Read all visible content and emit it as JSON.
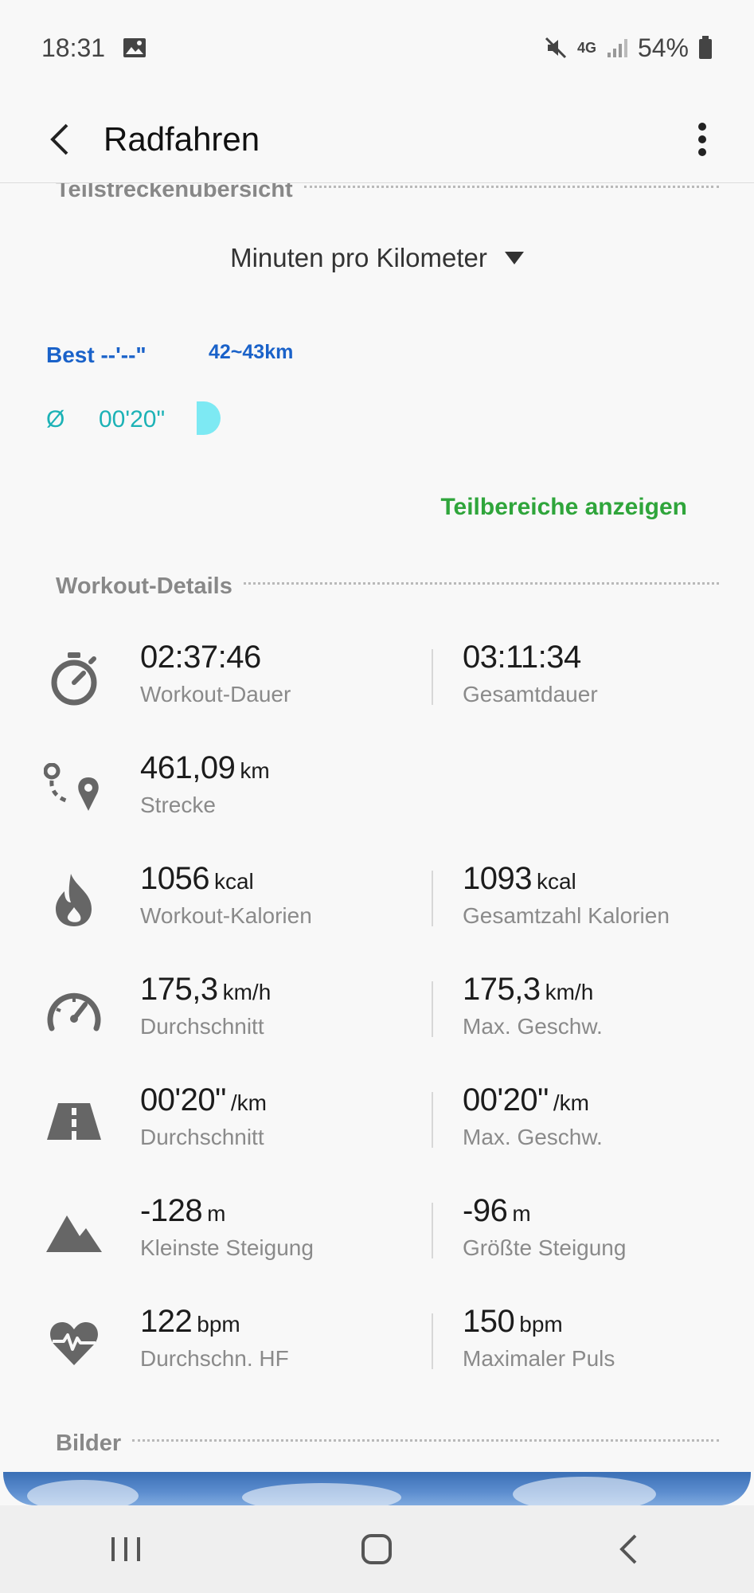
{
  "status_bar": {
    "time": "18:31",
    "network": "4G",
    "battery": "54%"
  },
  "app_bar": {
    "title": "Radfahren"
  },
  "split_overview": {
    "header": "Teilstreckenübersicht",
    "unit_selector": "Minuten pro Kilometer",
    "best_label": "Best --'--\"",
    "best_range": "42~43km",
    "avg_symbol": "Ø",
    "avg_value": "00'20\"",
    "show_segments": "Teilbereiche anzeigen"
  },
  "workout_details": {
    "header": "Workout-Details",
    "rows": [
      {
        "icon": "stopwatch-icon",
        "left": {
          "value": "02:37:46",
          "unit": "",
          "label": "Workout-Dauer"
        },
        "right": {
          "value": "03:11:34",
          "unit": "",
          "label": "Gesamtdauer"
        }
      },
      {
        "icon": "route-icon",
        "left": {
          "value": "461,09",
          "unit": "km",
          "label": "Strecke"
        }
      },
      {
        "icon": "flame-icon",
        "left": {
          "value": "1056",
          "unit": "kcal",
          "label": "Workout-Kalorien"
        },
        "right": {
          "value": "1093",
          "unit": "kcal",
          "label": "Gesamtzahl Kalorien"
        }
      },
      {
        "icon": "speedometer-icon",
        "left": {
          "value": "175,3",
          "unit": "km/h",
          "label": "Durchschnitt"
        },
        "right": {
          "value": "175,3",
          "unit": "km/h",
          "label": "Max. Geschw."
        }
      },
      {
        "icon": "road-icon",
        "left": {
          "value": "00'20\"",
          "unit": "/km",
          "label": "Durchschnitt"
        },
        "right": {
          "value": "00'20\"",
          "unit": "/km",
          "label": "Max. Geschw."
        }
      },
      {
        "icon": "mountain-icon",
        "left": {
          "value": "-128",
          "unit": "m",
          "label": "Kleinste Steigung"
        },
        "right": {
          "value": "-96",
          "unit": "m",
          "label": "Größte Steigung"
        }
      },
      {
        "icon": "heart-rate-icon",
        "left": {
          "value": "122",
          "unit": "bpm",
          "label": "Durchschn. HF"
        },
        "right": {
          "value": "150",
          "unit": "bpm",
          "label": "Maximaler Puls"
        }
      }
    ]
  },
  "pictures": {
    "header": "Bilder"
  },
  "colors": {
    "best": "#1a62c9",
    "average": "#1cb2b6",
    "split_bar": "#7de9f3",
    "link_green": "#2fa53b",
    "icon_gray": "#666666"
  }
}
